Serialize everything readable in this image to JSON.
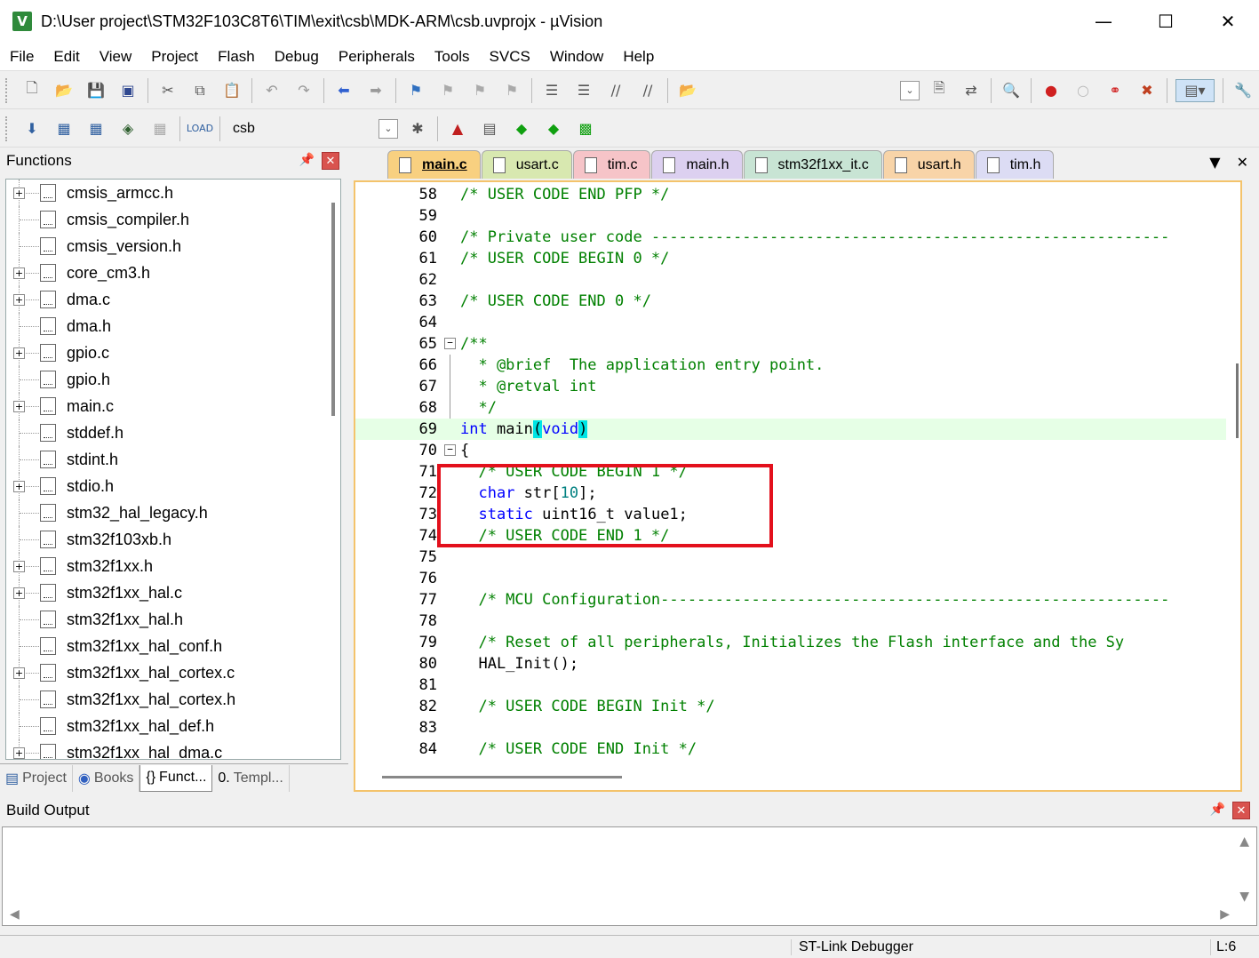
{
  "window": {
    "title": "D:\\User project\\STM32F103C8T6\\TIM\\exit\\csb\\MDK-ARM\\csb.uvprojx - µVision",
    "minimize": "—",
    "maximize": "☐",
    "close": "✕"
  },
  "menu": [
    "File",
    "Edit",
    "View",
    "Project",
    "Flash",
    "Debug",
    "Peripherals",
    "Tools",
    "SVCS",
    "Window",
    "Help"
  ],
  "toolbar": {
    "target": "csb"
  },
  "functions_pane": {
    "title": "Functions",
    "items": [
      {
        "label": "cmsis_armcc.h",
        "expand": true
      },
      {
        "label": "cmsis_compiler.h",
        "expand": false
      },
      {
        "label": "cmsis_version.h",
        "expand": false
      },
      {
        "label": "core_cm3.h",
        "expand": true
      },
      {
        "label": "dma.c",
        "expand": true
      },
      {
        "label": "dma.h",
        "expand": false
      },
      {
        "label": "gpio.c",
        "expand": true
      },
      {
        "label": "gpio.h",
        "expand": false
      },
      {
        "label": "main.c",
        "expand": true
      },
      {
        "label": "stddef.h",
        "expand": false
      },
      {
        "label": "stdint.h",
        "expand": false
      },
      {
        "label": "stdio.h",
        "expand": true
      },
      {
        "label": "stm32_hal_legacy.h",
        "expand": false
      },
      {
        "label": "stm32f103xb.h",
        "expand": false
      },
      {
        "label": "stm32f1xx.h",
        "expand": true
      },
      {
        "label": "stm32f1xx_hal.c",
        "expand": true
      },
      {
        "label": "stm32f1xx_hal.h",
        "expand": false
      },
      {
        "label": "stm32f1xx_hal_conf.h",
        "expand": false
      },
      {
        "label": "stm32f1xx_hal_cortex.c",
        "expand": true
      },
      {
        "label": "stm32f1xx_hal_cortex.h",
        "expand": false
      },
      {
        "label": "stm32f1xx_hal_def.h",
        "expand": false
      },
      {
        "label": "stm32f1xx_hal_dma.c",
        "expand": true
      }
    ],
    "tabs": [
      "Project",
      "Books",
      "Funct...",
      "Templ..."
    ]
  },
  "editor": {
    "tabs": [
      {
        "label": "main.c",
        "color": "#f8d080"
      },
      {
        "label": "usart.c",
        "color": "#d8e8b0"
      },
      {
        "label": "tim.c",
        "color": "#f6c4c8"
      },
      {
        "label": "main.h",
        "color": "#dcd0f0"
      },
      {
        "label": "stm32f1xx_it.c",
        "color": "#c8e4d4"
      },
      {
        "label": "usart.h",
        "color": "#f8d4a8"
      },
      {
        "label": "tim.h",
        "color": "#dcdcf4"
      }
    ],
    "active_tab": "main.c",
    "lines": [
      {
        "n": "58",
        "text": "/* USER CODE END PFP */"
      },
      {
        "n": "59",
        "text": ""
      },
      {
        "n": "60",
        "text": "/* Private user code ---------------------------------------------------------"
      },
      {
        "n": "61",
        "text": "/* USER CODE BEGIN 0 */"
      },
      {
        "n": "62",
        "text": ""
      },
      {
        "n": "63",
        "text": "/* USER CODE END 0 */"
      },
      {
        "n": "64",
        "text": ""
      },
      {
        "n": "65",
        "text": "/**"
      },
      {
        "n": "66",
        "text": "  * @brief  The application entry point."
      },
      {
        "n": "67",
        "text": "  * @retval int"
      },
      {
        "n": "68",
        "text": "  */"
      },
      {
        "n": "69",
        "text": "int main(void)"
      },
      {
        "n": "70",
        "text": "{"
      },
      {
        "n": "71",
        "text": "  /* USER CODE BEGIN 1 */"
      },
      {
        "n": "72",
        "text": "  char str[10];"
      },
      {
        "n": "73",
        "text": "  static uint16_t value1;"
      },
      {
        "n": "74",
        "text": "  /* USER CODE END 1 */"
      },
      {
        "n": "75",
        "text": ""
      },
      {
        "n": "76",
        "text": ""
      },
      {
        "n": "77",
        "text": "  /* MCU Configuration--------------------------------------------------------"
      },
      {
        "n": "78",
        "text": ""
      },
      {
        "n": "79",
        "text": "  /* Reset of all peripherals, Initializes the Flash interface and the Sy"
      },
      {
        "n": "80",
        "text": "  HAL_Init();"
      },
      {
        "n": "81",
        "text": ""
      },
      {
        "n": "82",
        "text": "  /* USER CODE BEGIN Init */"
      },
      {
        "n": "83",
        "text": ""
      },
      {
        "n": "84",
        "text": "  /* USER CODE END Init */"
      }
    ]
  },
  "build_output": {
    "title": "Build Output"
  },
  "status": {
    "debugger": "ST-Link Debugger",
    "position": "L:6"
  }
}
